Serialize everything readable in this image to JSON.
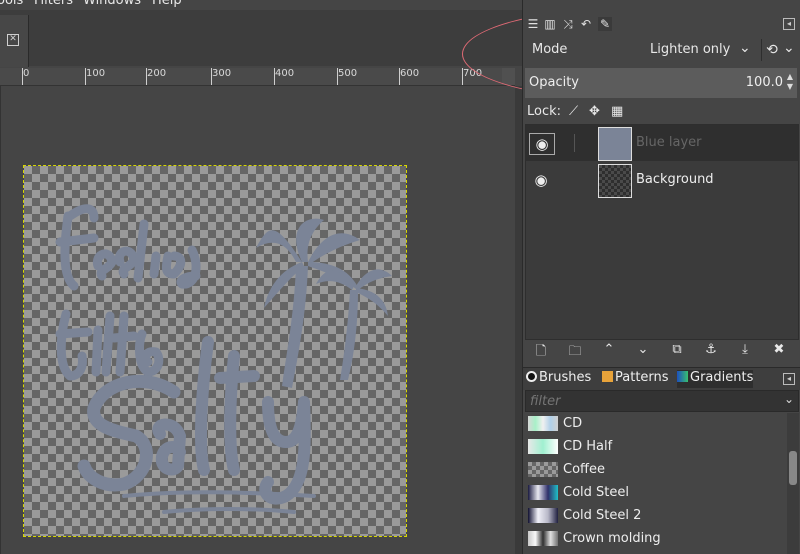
{
  "menubar": [
    "ools",
    "Filters",
    "Windows",
    "Help"
  ],
  "ruler": {
    "labels": [
      "0",
      "100",
      "200",
      "300",
      "400",
      "500",
      "600",
      "700"
    ]
  },
  "mode": {
    "label": "Mode",
    "value": "Lighten only"
  },
  "opacity": {
    "label": "Opacity",
    "value": "100.0"
  },
  "lock": {
    "label": "Lock:"
  },
  "layers": [
    {
      "name": "Blue layer",
      "selected": true
    },
    {
      "name": "Background",
      "selected": false
    }
  ],
  "resources": {
    "tabs": [
      "Brushes",
      "Patterns",
      "Gradients"
    ]
  },
  "filter": {
    "placeholder": "filter"
  },
  "gradients": [
    "CD",
    "CD Half",
    "Coffee",
    "Cold Steel",
    "Cold Steel 2",
    "Crown molding"
  ],
  "colors": {
    "text_art": "#7b8497",
    "annotation": "#e06a75"
  },
  "icons": {
    "layer_buttons": [
      "new-layer-icon",
      "new-group-icon",
      "raise-icon",
      "lower-icon",
      "duplicate-icon",
      "anchor-icon",
      "merge-down-icon",
      "delete-icon"
    ]
  }
}
